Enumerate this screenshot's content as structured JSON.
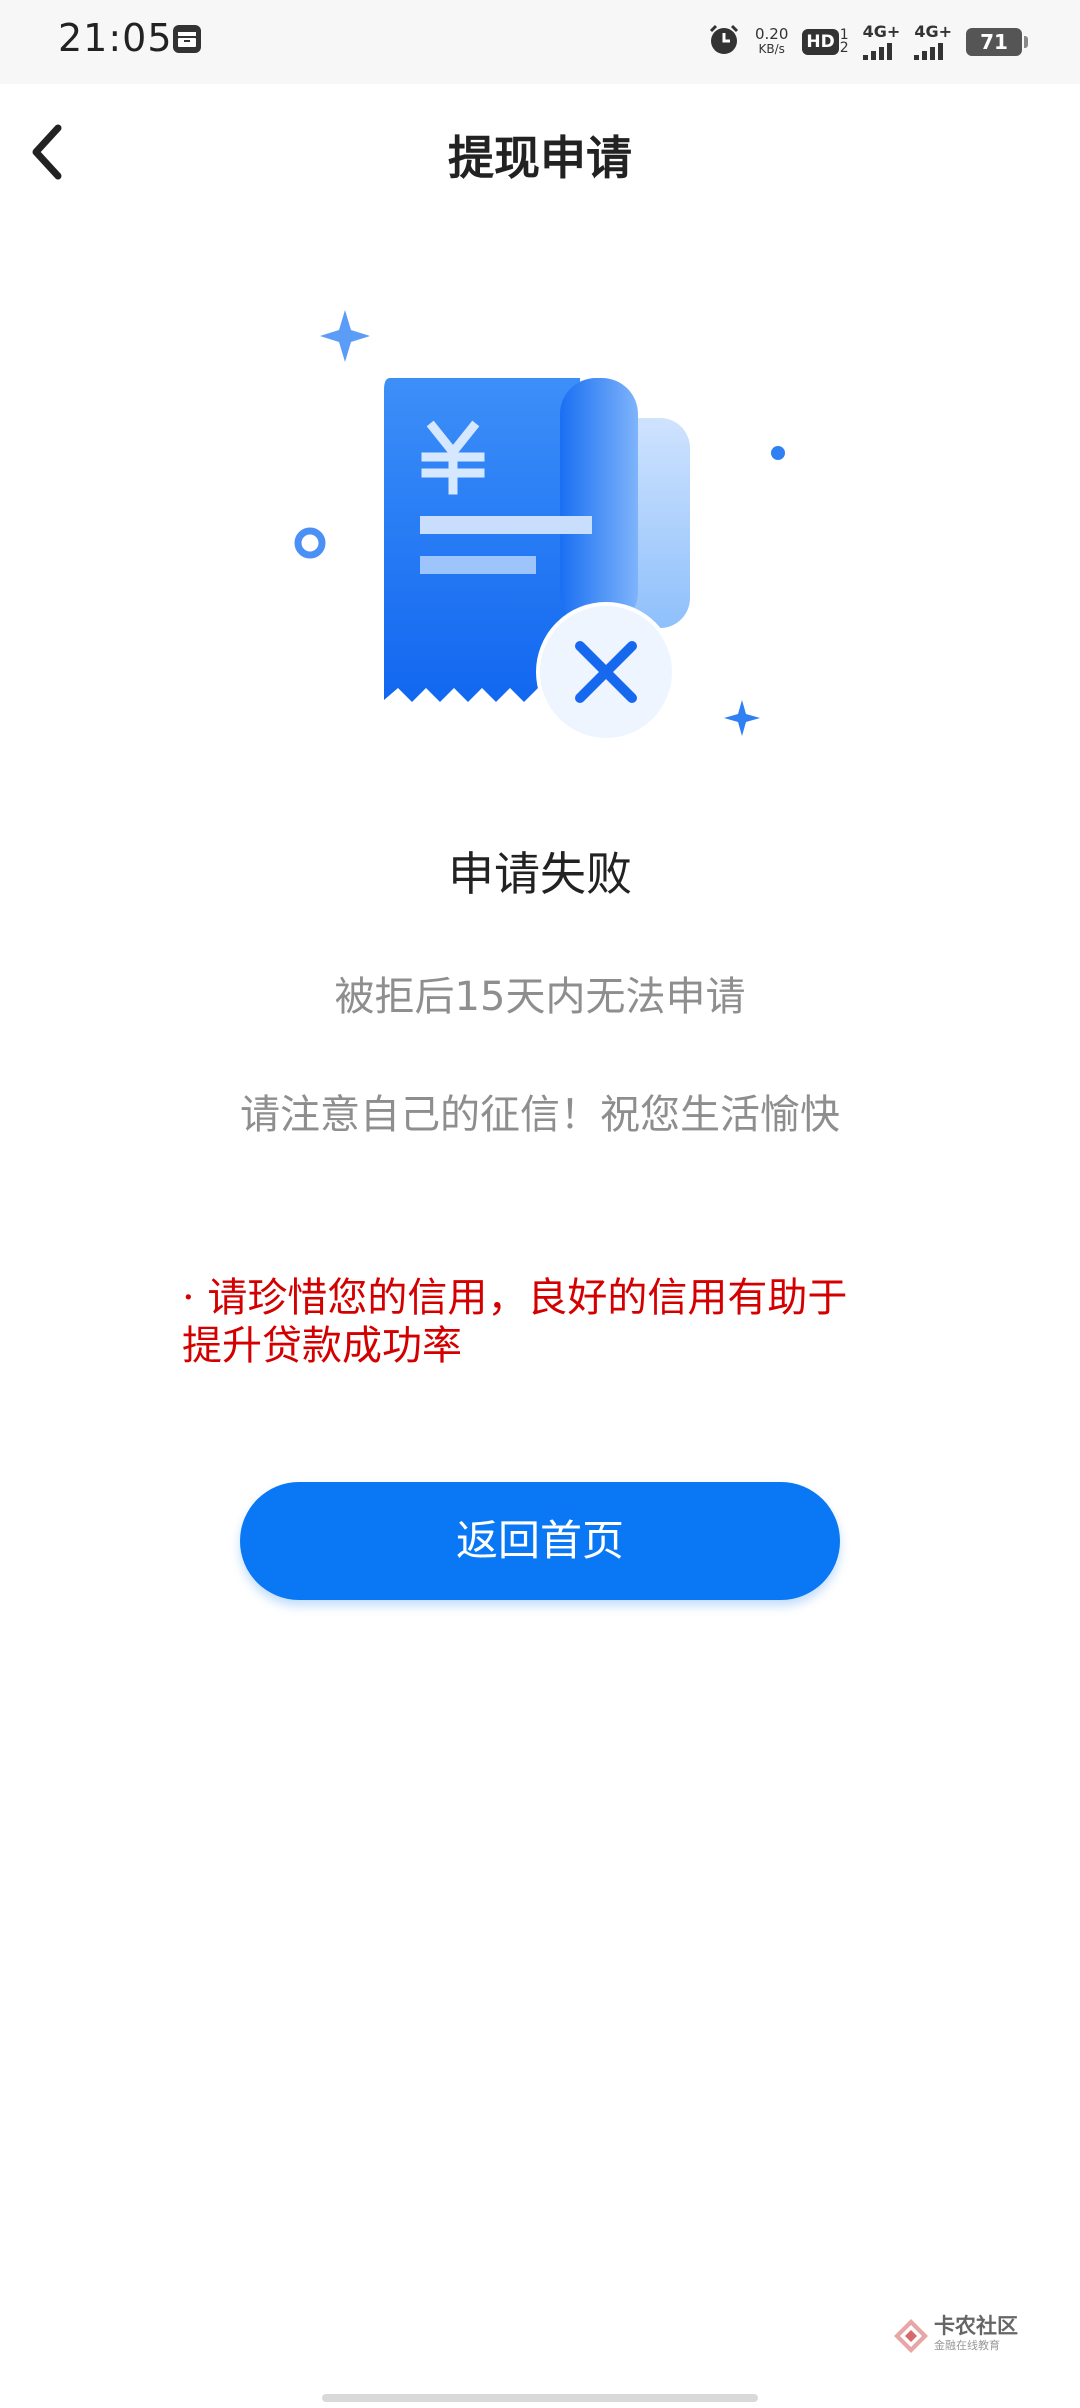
{
  "status_bar": {
    "time": "21:05",
    "net_speed_value": "0.20",
    "net_speed_unit": "KB/s",
    "hd_label": "HD",
    "hd_sub_top": "1",
    "hd_sub_bottom": "2",
    "signal1_label": "4G+",
    "signal2_label": "4G+",
    "battery": "71"
  },
  "nav": {
    "title": "提现申请"
  },
  "result": {
    "title": "申请失败",
    "message_1": "被拒后15天内无法申请",
    "message_2": "请注意自己的征信！祝您生活愉快"
  },
  "warning": {
    "text": "· 请珍惜您的信用，良好的信用有助于提升贷款成功率"
  },
  "buttons": {
    "home_label": "返回首页"
  },
  "watermark": {
    "main": "卡农社区",
    "sub": "金融在线教育"
  },
  "colors": {
    "primary": "#0a78f5",
    "warning": "#d40000",
    "muted_text": "#8e8e8e"
  }
}
